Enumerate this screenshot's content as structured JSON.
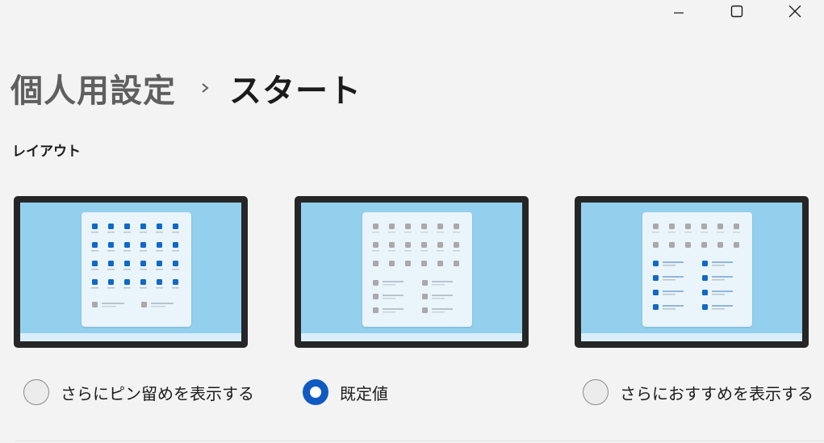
{
  "window": {
    "minimize_icon": "minimize-icon",
    "maximize_icon": "maximize-icon",
    "close_icon": "close-icon"
  },
  "breadcrumb": {
    "parent": "個人用設定",
    "separator_icon": "chevron-right-icon",
    "current": "スタート"
  },
  "layout_section": {
    "label": "レイアウト",
    "options": [
      {
        "label": "さらにピン留めを表示する",
        "selected": false
      },
      {
        "label": "既定値",
        "selected": true
      },
      {
        "label": "さらにおすすめを表示する",
        "selected": false
      }
    ]
  },
  "colors": {
    "accent": "#0f5ac2",
    "screen": "#93d0ee",
    "bezel": "#262626"
  }
}
